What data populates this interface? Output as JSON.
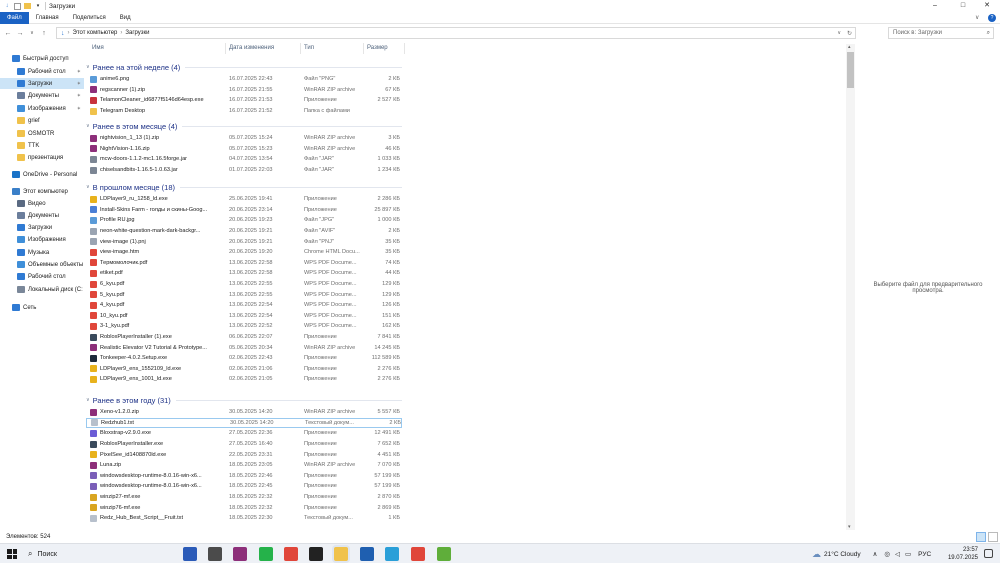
{
  "window": {
    "title": "Загрузки"
  },
  "ribbon": {
    "tabs": [
      "Файл",
      "Главная",
      "Поделиться",
      "Вид"
    ]
  },
  "address": {
    "crumbs": [
      "Этот компьютер",
      "Загрузки"
    ],
    "search_placeholder": "Поиск в: Загрузки"
  },
  "columns": {
    "name": "Имя",
    "date": "Дата изменения",
    "type": "Тип",
    "size": "Размер"
  },
  "nav": [
    {
      "label": "Быстрый доступ",
      "icon": "star-icon",
      "color": "#2f7ad3",
      "level": 0
    },
    {
      "label": "Рабочий стол",
      "icon": "desktop-icon",
      "color": "#2f7ad3",
      "level": 1,
      "pinned": true
    },
    {
      "label": "Загрузки",
      "icon": "download-icon",
      "color": "#2f7ad3",
      "level": 1,
      "pinned": true,
      "selected": true
    },
    {
      "label": "Документы",
      "icon": "document-icon",
      "color": "#6b7e9c",
      "level": 1,
      "pinned": true
    },
    {
      "label": "Изображения",
      "icon": "image-icon",
      "color": "#3f8fd9",
      "level": 1,
      "pinned": true
    },
    {
      "label": "grief",
      "icon": "folder-icon",
      "color": "#f0c24b",
      "level": 1
    },
    {
      "label": "OSMOTR",
      "icon": "folder-icon",
      "color": "#f0c24b",
      "level": 1
    },
    {
      "label": "TTK",
      "icon": "folder-icon",
      "color": "#f0c24b",
      "level": 1
    },
    {
      "label": "презентация",
      "icon": "folder-icon",
      "color": "#f0c24b",
      "level": 1
    },
    {
      "label": "OneDrive - Personal",
      "icon": "cloud-icon",
      "color": "#1a73c8",
      "level": 0
    },
    {
      "label": "Этот компьютер",
      "icon": "computer-icon",
      "color": "#3a7fc8",
      "level": 0
    },
    {
      "label": "Видео",
      "icon": "video-icon",
      "color": "#5a6a82",
      "level": 1
    },
    {
      "label": "Документы",
      "icon": "document-icon",
      "color": "#6b7e9c",
      "level": 1
    },
    {
      "label": "Загрузки",
      "icon": "download-icon",
      "color": "#2f7ad3",
      "level": 1
    },
    {
      "label": "Изображения",
      "icon": "image-icon",
      "color": "#3f8fd9",
      "level": 1
    },
    {
      "label": "Музыка",
      "icon": "music-icon",
      "color": "#2f7ad3",
      "level": 1
    },
    {
      "label": "Объемные объекты",
      "icon": "cube-icon",
      "color": "#3f8fd9",
      "level": 1
    },
    {
      "label": "Рабочий стол",
      "icon": "desktop-icon",
      "color": "#2f7ad3",
      "level": 1
    },
    {
      "label": "Локальный диск (C:",
      "icon": "drive-icon",
      "color": "#7a8799",
      "level": 1
    },
    {
      "label": "Сеть",
      "icon": "network-icon",
      "color": "#2f7ad3",
      "level": 0
    }
  ],
  "groups": [
    {
      "title": "Ранее на этой неделе (4)",
      "files": [
        {
          "name": "anime6.png",
          "date": "16.07.2025 22:43",
          "type": "Файл \"PNG\"",
          "size": "2 КБ",
          "icon": "image-file-icon",
          "color": "#5a9bd8"
        },
        {
          "name": "regscanner (1).zip",
          "date": "16.07.2025 21:55",
          "type": "WinRAR ZIP archive",
          "size": "67 КБ",
          "icon": "winrar-icon",
          "color": "#8d2f7a"
        },
        {
          "name": "TelamonCleaner_id6877f5146d64esp.exe",
          "date": "16.07.2025 21:53",
          "type": "Приложение",
          "size": "2 527 КБ",
          "icon": "app-icon",
          "color": "#c8323c"
        },
        {
          "name": "Telegram Desktop",
          "date": "16.07.2025 21:52",
          "type": "Папка с файлами",
          "size": "",
          "icon": "folder-icon",
          "color": "#f0c24b"
        }
      ]
    },
    {
      "title": "Ранее в этом месяце (4)",
      "files": [
        {
          "name": "nightvision_1_13 (1).zip",
          "date": "05.07.2025 15:24",
          "type": "WinRAR ZIP archive",
          "size": "3 КБ",
          "icon": "winrar-icon",
          "color": "#8d2f7a"
        },
        {
          "name": "NightVision-1.16.zip",
          "date": "05.07.2025 15:23",
          "type": "WinRAR ZIP archive",
          "size": "46 КБ",
          "icon": "winrar-icon",
          "color": "#8d2f7a"
        },
        {
          "name": "mcw-doors-1.1.2-mc1.16.5forge.jar",
          "date": "04.07.2025 13:54",
          "type": "Файл \"JAR\"",
          "size": "1 033 КБ",
          "icon": "jar-icon",
          "color": "#7c8694"
        },
        {
          "name": "chiselsandbits-1.16.5-1.0.63.jar",
          "date": "01.07.2025 22:03",
          "type": "Файл \"JAR\"",
          "size": "1 234 КБ",
          "icon": "jar-icon",
          "color": "#7c8694"
        }
      ]
    },
    {
      "title": "В прошлом месяце (18)",
      "files": [
        {
          "name": "LDPlayer9_ru_1258_ld.exe",
          "date": "25.06.2025 19:41",
          "type": "Приложение",
          "size": "2 286 КБ",
          "icon": "ldplayer-icon",
          "color": "#e8b21c"
        },
        {
          "name": "Install-Skins Farm - голды и скины-Goog...",
          "date": "20.06.2025 23:14",
          "type": "Приложение",
          "size": "25 897 КБ",
          "icon": "app-icon",
          "color": "#4a7fd6"
        },
        {
          "name": "Profile RU.jpg",
          "date": "20.06.2025 19:23",
          "type": "Файл \"JPG\"",
          "size": "1 000 КБ",
          "icon": "image-file-icon",
          "color": "#5a9bd8"
        },
        {
          "name": "neon-white-question-mark-dark-backgr...",
          "date": "20.06.2025 19:21",
          "type": "Файл \"AVIF\"",
          "size": "2 КБ",
          "icon": "file-icon",
          "color": "#9aa4b2"
        },
        {
          "name": "view-image (1).pnj",
          "date": "20.06.2025 19:21",
          "type": "Файл \"PNJ\"",
          "size": "35 КБ",
          "icon": "file-icon",
          "color": "#9aa4b2"
        },
        {
          "name": "view-image.htm",
          "date": "20.06.2025 19:20",
          "type": "Chrome HTML Docu...",
          "size": "35 КБ",
          "icon": "chrome-icon",
          "color": "#e0463a"
        },
        {
          "name": "Термомолочик.pdf",
          "date": "13.06.2025 22:58",
          "type": "WPS PDF Docume...",
          "size": "74 КБ",
          "icon": "pdf-icon",
          "color": "#e0463a"
        },
        {
          "name": "etiket.pdf",
          "date": "13.06.2025 22:58",
          "type": "WPS PDF Docume...",
          "size": "44 КБ",
          "icon": "pdf-icon",
          "color": "#e0463a"
        },
        {
          "name": "6_kyu.pdf",
          "date": "13.06.2025 22:55",
          "type": "WPS PDF Docume...",
          "size": "129 КБ",
          "icon": "pdf-icon",
          "color": "#e0463a"
        },
        {
          "name": "5_kyu.pdf",
          "date": "13.06.2025 22:55",
          "type": "WPS PDF Docume...",
          "size": "129 КБ",
          "icon": "pdf-icon",
          "color": "#e0463a"
        },
        {
          "name": "4_kyu.pdf",
          "date": "13.06.2025 22:54",
          "type": "WPS PDF Docume...",
          "size": "126 КБ",
          "icon": "pdf-icon",
          "color": "#e0463a"
        },
        {
          "name": "10_kyu.pdf",
          "date": "13.06.2025 22:54",
          "type": "WPS PDF Docume...",
          "size": "151 КБ",
          "icon": "pdf-icon",
          "color": "#e0463a"
        },
        {
          "name": "3-1_kyu.pdf",
          "date": "13.06.2025 22:52",
          "type": "WPS PDF Docume...",
          "size": "162 КБ",
          "icon": "pdf-icon",
          "color": "#e0463a"
        },
        {
          "name": "RobloxPlayerInstaller (1).exe",
          "date": "06.06.2025 22:07",
          "type": "Приложение",
          "size": "7 841 КБ",
          "icon": "roblox-icon",
          "color": "#3a4a5c"
        },
        {
          "name": "Realistic Elevator V2 Tutorial & Prototype...",
          "date": "05.06.2025 20:34",
          "type": "WinRAR ZIP archive",
          "size": "14 245 КБ",
          "icon": "winrar-icon",
          "color": "#8d2f7a"
        },
        {
          "name": "Tonkeeper-4.0.2.Setup.exe",
          "date": "02.06.2025 22:43",
          "type": "Приложение",
          "size": "112 589 КБ",
          "icon": "app-icon",
          "color": "#1d2a3a"
        },
        {
          "name": "LDPlayer9_ens_1552109_ld.exe",
          "date": "02.06.2025 21:06",
          "type": "Приложение",
          "size": "2 276 КБ",
          "icon": "ldplayer-icon",
          "color": "#e8b21c"
        },
        {
          "name": "LDPlayer9_ens_1001_ld.exe",
          "date": "02.06.2025 21:05",
          "type": "Приложение",
          "size": "2 276 КБ",
          "icon": "ldplayer-icon",
          "color": "#e8b21c"
        }
      ]
    },
    {
      "title": "Ранее в этом году (31)",
      "files": [
        {
          "name": "Xeno-v1.2.0.zip",
          "date": "30.05.2025 14:20",
          "type": "WinRAR ZIP archive",
          "size": "5 557 КБ",
          "icon": "winrar-icon",
          "color": "#8d2f7a"
        },
        {
          "name": "Redzhub1.txt",
          "date": "30.05.2025 14:20",
          "type": "Текстовый докум...",
          "size": "2 КБ",
          "icon": "text-file-icon",
          "color": "#b7c0cc",
          "selected": true
        },
        {
          "name": "Bloxstrap-v2.9.0.exe",
          "date": "27.05.2025 22:36",
          "type": "Приложение",
          "size": "12 491 КБ",
          "icon": "app-icon",
          "color": "#6b5cd6"
        },
        {
          "name": "RobloxPlayerInstaller.exe",
          "date": "27.05.2025 16:40",
          "type": "Приложение",
          "size": "7 652 КБ",
          "icon": "roblox-icon",
          "color": "#3a4a5c"
        },
        {
          "name": "PixelSee_id1408870ld.exe",
          "date": "22.05.2025 23:31",
          "type": "Приложение",
          "size": "4 451 КБ",
          "icon": "app-icon",
          "color": "#e8b21c"
        },
        {
          "name": "Luna.zip",
          "date": "18.05.2025 23:05",
          "type": "WinRAR ZIP archive",
          "size": "7 070 КБ",
          "icon": "winrar-icon",
          "color": "#8d2f7a"
        },
        {
          "name": "windowsdesktop-runtime-8.0.16-win-x6...",
          "date": "18.05.2025 22:46",
          "type": "Приложение",
          "size": "57 199 КБ",
          "icon": "app-icon",
          "color": "#7b5fb8"
        },
        {
          "name": "windowsdesktop-runtime-8.0.16-win-x6...",
          "date": "18.05.2025 22:45",
          "type": "Приложение",
          "size": "57 199 КБ",
          "icon": "app-icon",
          "color": "#7b5fb8"
        },
        {
          "name": "winzip27-mf.exe",
          "date": "18.05.2025 22:32",
          "type": "Приложение",
          "size": "2 870 КБ",
          "icon": "winzip-icon",
          "color": "#d9a520"
        },
        {
          "name": "winzip76-mf.exe",
          "date": "18.05.2025 22:32",
          "type": "Приложение",
          "size": "2 869 КБ",
          "icon": "winzip-icon",
          "color": "#d9a520"
        },
        {
          "name": "Redz_Hub_Best_Script__Fruit.txt",
          "date": "18.05.2025 22:30",
          "type": "Текстовый докум...",
          "size": "1 КБ",
          "icon": "text-file-icon",
          "color": "#b7c0cc"
        }
      ]
    }
  ],
  "preview": {
    "message": "Выберите файл для предварительного просмотра."
  },
  "status": {
    "count": "Элементов: 524"
  },
  "taskbar": {
    "search": "Поиск",
    "weather": "21°C  Cloudy",
    "lang": "РУС",
    "time": "23:57",
    "date": "19.07.2025",
    "apps": [
      {
        "icon": "word-icon",
        "color": "#2b5bb8"
      },
      {
        "icon": "minecraft-icon",
        "color": "#4b4b4b"
      },
      {
        "icon": "winrar-icon",
        "color": "#8d2f7a"
      },
      {
        "icon": "whatsapp-icon",
        "color": "#25b24a"
      },
      {
        "icon": "chrome-icon",
        "color": "#e0463a"
      },
      {
        "icon": "terminal-icon",
        "color": "#222"
      },
      {
        "icon": "explorer-icon",
        "color": "#f0c24b"
      },
      {
        "icon": "defender-icon",
        "color": "#1f5fb0"
      },
      {
        "icon": "telegram-icon",
        "color": "#2a9fd8"
      },
      {
        "icon": "chrome-icon",
        "color": "#e0463a"
      },
      {
        "icon": "cube-app-icon",
        "color": "#5fae3a"
      }
    ]
  }
}
